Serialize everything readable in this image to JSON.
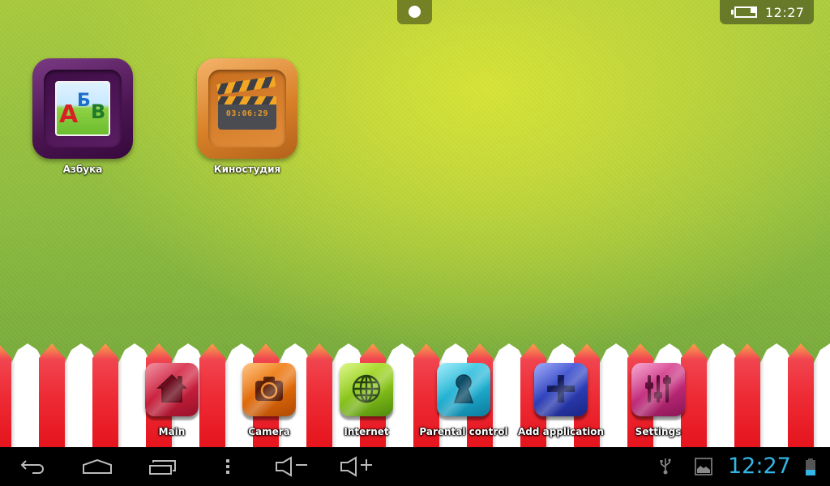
{
  "status_bar_top": {
    "time": "12:27",
    "battery_icon": "battery-low-icon"
  },
  "drawer_handle": {
    "icon": "dot-icon"
  },
  "desktop_apps": [
    {
      "label": "Азбука",
      "icon": "abc-letters-icon",
      "letters": [
        "А",
        "Б",
        "В"
      ]
    },
    {
      "label": "Киностудия",
      "icon": "clapperboard-icon",
      "timecode": "03:06:29"
    }
  ],
  "dock": {
    "items": [
      {
        "label": "Main",
        "icon": "home-icon",
        "color": "#c8203c"
      },
      {
        "label": "Camera",
        "icon": "camera-icon",
        "color": "#e06a0a"
      },
      {
        "label": "Internet",
        "icon": "globe-icon",
        "color": "#86c21a"
      },
      {
        "label": "Parental control",
        "icon": "keyhole-icon",
        "color": "#1eaed0"
      },
      {
        "label": "Add application",
        "icon": "plus-icon",
        "color": "#2d3fb8"
      },
      {
        "label": "Settings",
        "icon": "sliders-icon",
        "color": "#c02a7a"
      }
    ]
  },
  "nav_bar": {
    "buttons": [
      "back-icon",
      "home-outline-icon",
      "recent-apps-icon",
      "menu-dots-icon",
      "volume-down-icon",
      "volume-up-icon"
    ],
    "status_icons": [
      "usb-icon",
      "image-icon"
    ],
    "time": "12:27",
    "time_color": "#33b5e5",
    "battery_icon": "battery-icon"
  },
  "colors": {
    "fence_red": "#ee2c36",
    "fence_white": "#ffffff",
    "background_green": "#8fbd40",
    "background_highlight": "#d8e436"
  }
}
